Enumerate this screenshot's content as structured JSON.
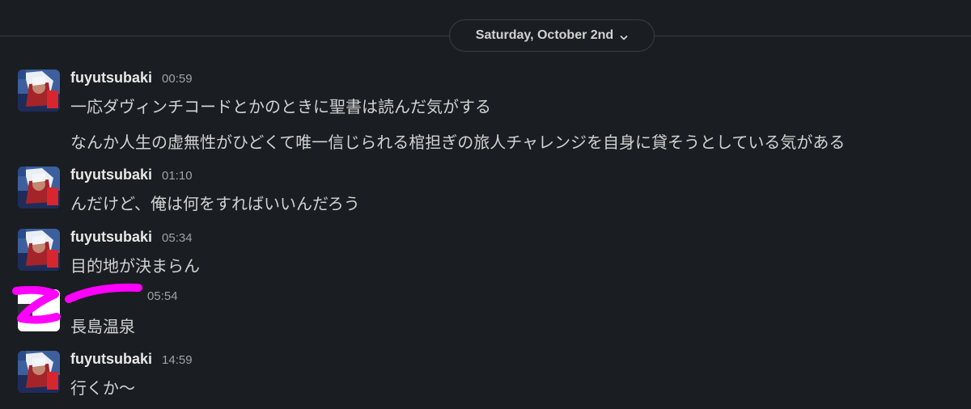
{
  "date_divider": {
    "label": "Saturday, October 2nd"
  },
  "messages": [
    {
      "user": "fuyutsubaki",
      "time": "00:59",
      "lines": [
        "一応ダヴィンチコードとかのときに聖書は読んだ気がする",
        "なんか人生の虚無性がひどくて唯一信じられる棺担ぎの旅人チャレンジを自身に貸そうとしている気がある"
      ]
    },
    {
      "user": "fuyutsubaki",
      "time": "01:10",
      "lines": [
        "んだけど、俺は何をすればいいんだろう"
      ]
    },
    {
      "user": "fuyutsubaki",
      "time": "05:34",
      "lines": [
        "目的地が決まらん"
      ]
    },
    {
      "user": "",
      "time": "05:54",
      "lines": [
        "長島温泉"
      ]
    },
    {
      "user": "fuyutsubaki",
      "time": "14:59",
      "lines": [
        "行くか〜"
      ]
    }
  ],
  "colors": {
    "background": "#1a1d21",
    "redaction": "#ff00ff",
    "text": "#d1d2d3",
    "timestamp": "#a0a3a6"
  },
  "icons": {
    "date_chevron": "chevron-down-icon",
    "avatar": "anime-character-avatar",
    "redaction": "magenta-scribble-redaction"
  }
}
